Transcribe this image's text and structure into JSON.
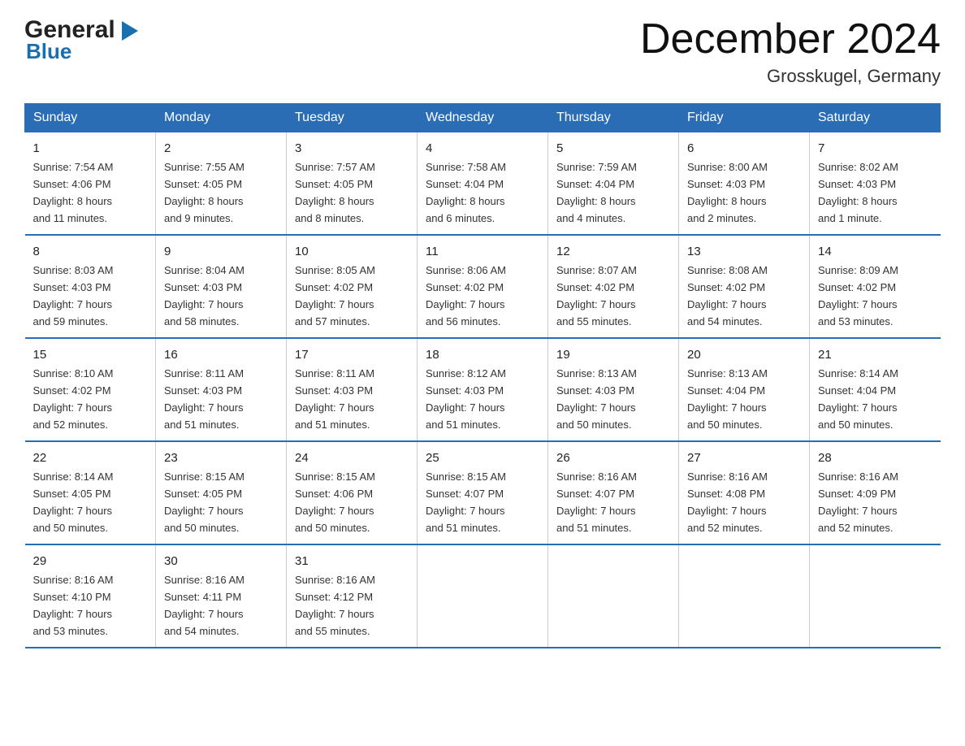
{
  "logo": {
    "general": "General",
    "blue": "Blue",
    "arrow": "▶"
  },
  "title": "December 2024",
  "subtitle": "Grosskugel, Germany",
  "days_of_week": [
    "Sunday",
    "Monday",
    "Tuesday",
    "Wednesday",
    "Thursday",
    "Friday",
    "Saturday"
  ],
  "weeks": [
    [
      {
        "day": "1",
        "info": "Sunrise: 7:54 AM\nSunset: 4:06 PM\nDaylight: 8 hours\nand 11 minutes."
      },
      {
        "day": "2",
        "info": "Sunrise: 7:55 AM\nSunset: 4:05 PM\nDaylight: 8 hours\nand 9 minutes."
      },
      {
        "day": "3",
        "info": "Sunrise: 7:57 AM\nSunset: 4:05 PM\nDaylight: 8 hours\nand 8 minutes."
      },
      {
        "day": "4",
        "info": "Sunrise: 7:58 AM\nSunset: 4:04 PM\nDaylight: 8 hours\nand 6 minutes."
      },
      {
        "day": "5",
        "info": "Sunrise: 7:59 AM\nSunset: 4:04 PM\nDaylight: 8 hours\nand 4 minutes."
      },
      {
        "day": "6",
        "info": "Sunrise: 8:00 AM\nSunset: 4:03 PM\nDaylight: 8 hours\nand 2 minutes."
      },
      {
        "day": "7",
        "info": "Sunrise: 8:02 AM\nSunset: 4:03 PM\nDaylight: 8 hours\nand 1 minute."
      }
    ],
    [
      {
        "day": "8",
        "info": "Sunrise: 8:03 AM\nSunset: 4:03 PM\nDaylight: 7 hours\nand 59 minutes."
      },
      {
        "day": "9",
        "info": "Sunrise: 8:04 AM\nSunset: 4:03 PM\nDaylight: 7 hours\nand 58 minutes."
      },
      {
        "day": "10",
        "info": "Sunrise: 8:05 AM\nSunset: 4:02 PM\nDaylight: 7 hours\nand 57 minutes."
      },
      {
        "day": "11",
        "info": "Sunrise: 8:06 AM\nSunset: 4:02 PM\nDaylight: 7 hours\nand 56 minutes."
      },
      {
        "day": "12",
        "info": "Sunrise: 8:07 AM\nSunset: 4:02 PM\nDaylight: 7 hours\nand 55 minutes."
      },
      {
        "day": "13",
        "info": "Sunrise: 8:08 AM\nSunset: 4:02 PM\nDaylight: 7 hours\nand 54 minutes."
      },
      {
        "day": "14",
        "info": "Sunrise: 8:09 AM\nSunset: 4:02 PM\nDaylight: 7 hours\nand 53 minutes."
      }
    ],
    [
      {
        "day": "15",
        "info": "Sunrise: 8:10 AM\nSunset: 4:02 PM\nDaylight: 7 hours\nand 52 minutes."
      },
      {
        "day": "16",
        "info": "Sunrise: 8:11 AM\nSunset: 4:03 PM\nDaylight: 7 hours\nand 51 minutes."
      },
      {
        "day": "17",
        "info": "Sunrise: 8:11 AM\nSunset: 4:03 PM\nDaylight: 7 hours\nand 51 minutes."
      },
      {
        "day": "18",
        "info": "Sunrise: 8:12 AM\nSunset: 4:03 PM\nDaylight: 7 hours\nand 51 minutes."
      },
      {
        "day": "19",
        "info": "Sunrise: 8:13 AM\nSunset: 4:03 PM\nDaylight: 7 hours\nand 50 minutes."
      },
      {
        "day": "20",
        "info": "Sunrise: 8:13 AM\nSunset: 4:04 PM\nDaylight: 7 hours\nand 50 minutes."
      },
      {
        "day": "21",
        "info": "Sunrise: 8:14 AM\nSunset: 4:04 PM\nDaylight: 7 hours\nand 50 minutes."
      }
    ],
    [
      {
        "day": "22",
        "info": "Sunrise: 8:14 AM\nSunset: 4:05 PM\nDaylight: 7 hours\nand 50 minutes."
      },
      {
        "day": "23",
        "info": "Sunrise: 8:15 AM\nSunset: 4:05 PM\nDaylight: 7 hours\nand 50 minutes."
      },
      {
        "day": "24",
        "info": "Sunrise: 8:15 AM\nSunset: 4:06 PM\nDaylight: 7 hours\nand 50 minutes."
      },
      {
        "day": "25",
        "info": "Sunrise: 8:15 AM\nSunset: 4:07 PM\nDaylight: 7 hours\nand 51 minutes."
      },
      {
        "day": "26",
        "info": "Sunrise: 8:16 AM\nSunset: 4:07 PM\nDaylight: 7 hours\nand 51 minutes."
      },
      {
        "day": "27",
        "info": "Sunrise: 8:16 AM\nSunset: 4:08 PM\nDaylight: 7 hours\nand 52 minutes."
      },
      {
        "day": "28",
        "info": "Sunrise: 8:16 AM\nSunset: 4:09 PM\nDaylight: 7 hours\nand 52 minutes."
      }
    ],
    [
      {
        "day": "29",
        "info": "Sunrise: 8:16 AM\nSunset: 4:10 PM\nDaylight: 7 hours\nand 53 minutes."
      },
      {
        "day": "30",
        "info": "Sunrise: 8:16 AM\nSunset: 4:11 PM\nDaylight: 7 hours\nand 54 minutes."
      },
      {
        "day": "31",
        "info": "Sunrise: 8:16 AM\nSunset: 4:12 PM\nDaylight: 7 hours\nand 55 minutes."
      },
      null,
      null,
      null,
      null
    ]
  ]
}
